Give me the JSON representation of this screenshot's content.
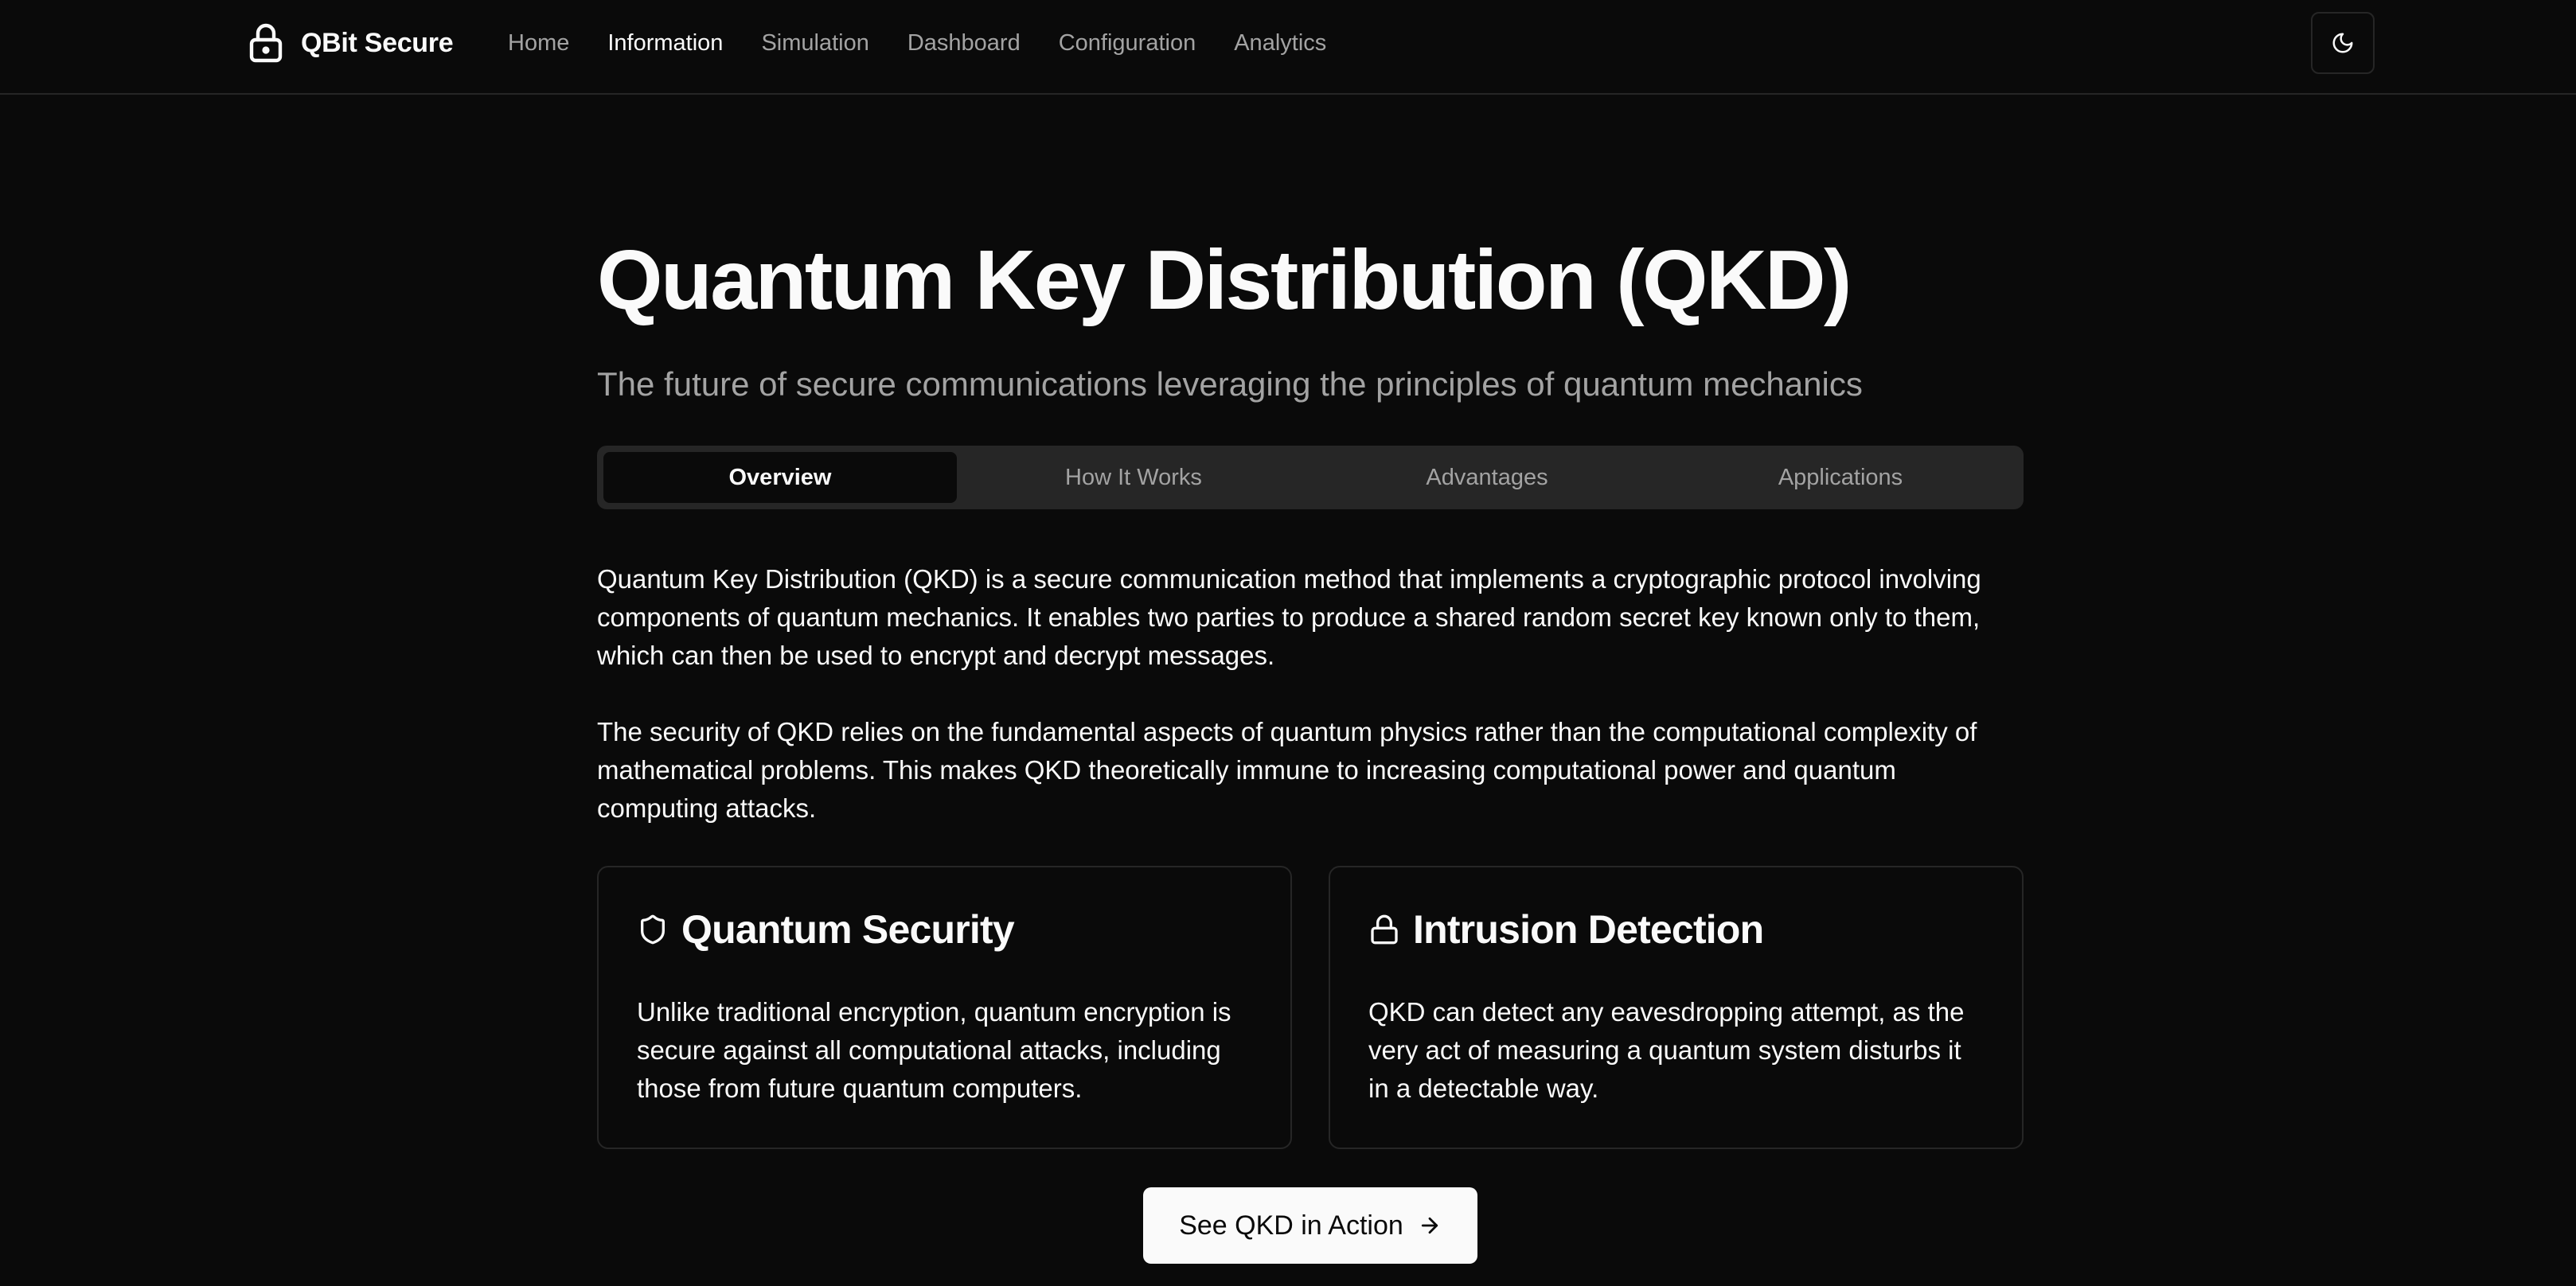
{
  "nav": {
    "brand": "QBit Secure",
    "brand_icon": "lock-icon",
    "links": [
      {
        "label": "Home",
        "active": false
      },
      {
        "label": "Information",
        "active": true
      },
      {
        "label": "Simulation",
        "active": false
      },
      {
        "label": "Dashboard",
        "active": false
      },
      {
        "label": "Configuration",
        "active": false
      },
      {
        "label": "Analytics",
        "active": false
      }
    ],
    "theme_toggle_icon": "moon-icon"
  },
  "page": {
    "title": "Quantum Key Distribution (QKD)",
    "subtitle": "The future of secure communications leveraging the principles of quantum mechanics"
  },
  "tabs": [
    {
      "label": "Overview",
      "active": true
    },
    {
      "label": "How It Works",
      "active": false
    },
    {
      "label": "Advantages",
      "active": false
    },
    {
      "label": "Applications",
      "active": false
    }
  ],
  "overview": {
    "paragraphs": [
      "Quantum Key Distribution (QKD) is a secure communication method that implements a cryptographic protocol involving components of quantum mechanics. It enables two parties to produce a shared random secret key known only to them, which can then be used to encrypt and decrypt messages.",
      "The security of QKD relies on the fundamental aspects of quantum physics rather than the computational complexity of mathematical problems. This makes QKD theoretically immune to increasing computational power and quantum computing attacks."
    ],
    "cards": [
      {
        "icon": "shield-icon",
        "title": "Quantum Security",
        "body": "Unlike traditional encryption, quantum encryption is secure against all computational attacks, including those from future quantum computers."
      },
      {
        "icon": "lock-icon",
        "title": "Intrusion Detection",
        "body": "QKD can detect any eavesdropping attempt, as the very act of measuring a quantum system disturbs it in a detectable way."
      }
    ],
    "cta_label": "See QKD in Action",
    "cta_icon": "arrow-right-icon"
  },
  "colors": {
    "background": "#0a0a0a",
    "foreground": "#fafafa",
    "muted": "#a3a3a3",
    "border": "#262626",
    "button_bg": "#fafafa",
    "button_fg": "#0a0a0a"
  }
}
